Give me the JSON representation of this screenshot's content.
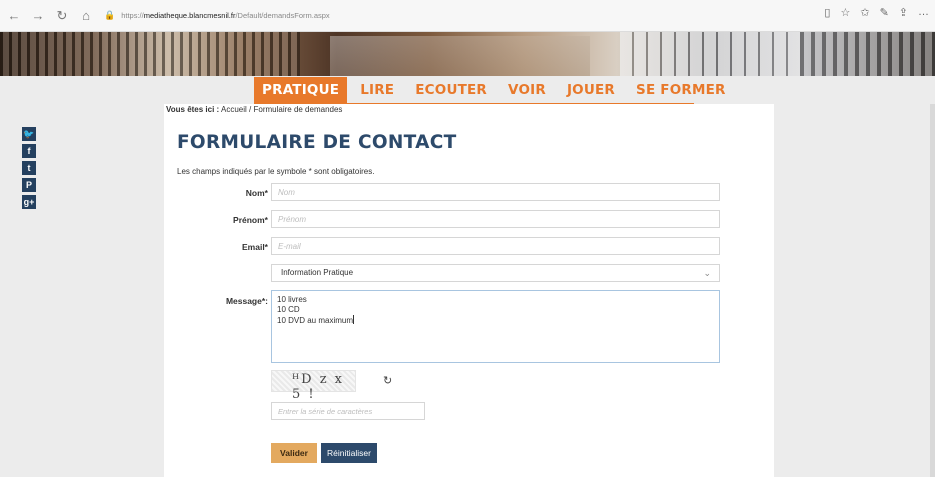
{
  "browser": {
    "back": "←",
    "forward": "→",
    "refresh": "↻",
    "home": "⌂",
    "url_prefix": "https://",
    "url_host": "mediatheque.blancmesnil.fr",
    "url_path": "/Default/demandsForm.aspx"
  },
  "menu": {
    "items": [
      "PRATIQUE",
      "LIRE",
      "ECOUTER",
      "VOIR",
      "JOUER",
      "SE FORMER"
    ],
    "active": "PRATIQUE"
  },
  "social": [
    "twitter-icon",
    "facebook-icon",
    "tumblr-icon",
    "pinterest-icon",
    "google-plus-icon"
  ],
  "breadcrumb": {
    "prefix": "Vous êtes ici :",
    "home": "Accueil",
    "separator": "/",
    "current": "Formulaire de demandes"
  },
  "page": {
    "title": "FORMULAIRE DE CONTACT",
    "intro": "Les champs indiqués par le symbole * sont obligatoires."
  },
  "form": {
    "nom_label": "Nom*",
    "nom_placeholder": "Nom",
    "prenom_label": "Prénom*",
    "prenom_placeholder": "Prénom",
    "email_label": "Email*",
    "email_placeholder": "E-mail",
    "select_value": "Information Pratique",
    "message_label": "Message*:",
    "message_lines": [
      "10 livres",
      "10 CD",
      "10 DVD au maximum"
    ],
    "captcha_text": "ᴴD z x 5 !",
    "captcha_placeholder": "Entrer la série de caractères",
    "submit_label": "Valider",
    "reset_label": "Réinitialiser"
  },
  "colors": {
    "accent": "#e8792b",
    "navy": "#2d4a6b",
    "submit": "#e3a95f"
  }
}
